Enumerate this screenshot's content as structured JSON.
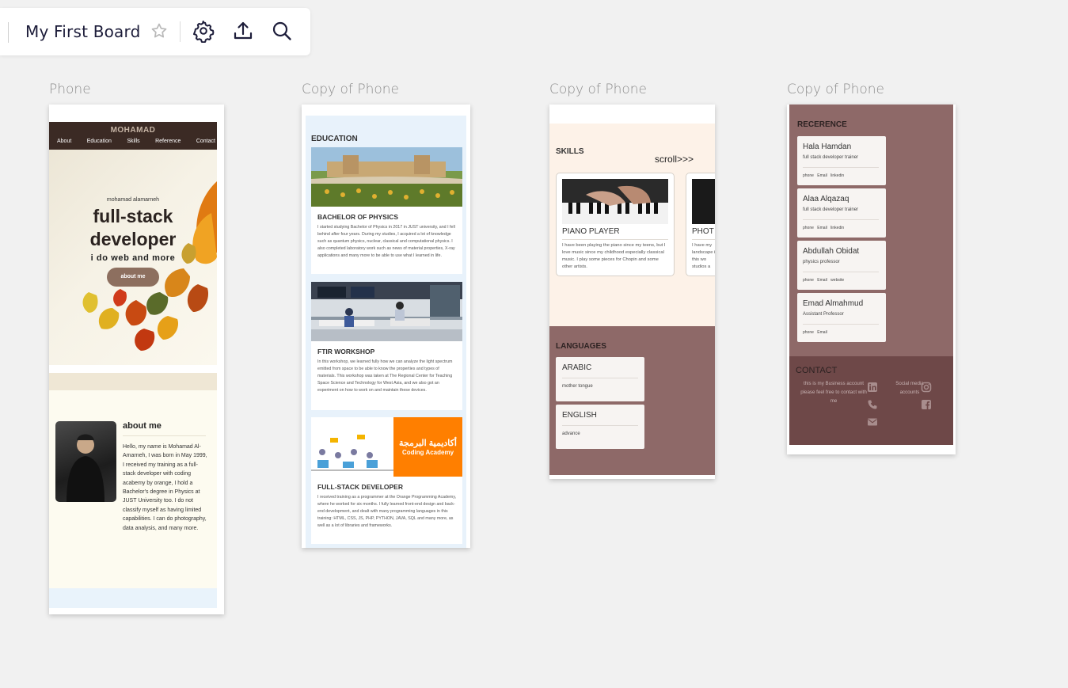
{
  "toolbar": {
    "board_title": "My First Board",
    "icons": [
      "star-icon",
      "gear-icon",
      "upload-icon",
      "search-icon"
    ]
  },
  "frames": [
    {
      "label": "Phone"
    },
    {
      "label": "Copy of Phone"
    },
    {
      "label": "Copy of Phone"
    },
    {
      "label": "Copy of Phone"
    }
  ],
  "phone1": {
    "brand": "MOHAMAD",
    "nav": [
      "About",
      "Education",
      "Skills",
      "Reference",
      "Contact"
    ],
    "hero_sub": "mohamad alamarneh",
    "hero_title_1": "full-stack",
    "hero_title_2": "developer",
    "hero_tagline": "i do web and more",
    "hero_button": "about me",
    "about_heading": "about me",
    "about_body": "Hello, my name is Mohamad Al-Amarneh, I was born in May 1999, I received my training as a full-stack developer with coding acabemy by orange, I hold a Bachelor's degree in Physics at JUST University too. I do not classify myself as having limited capabilities. I can do photography, data analysis, and many more."
  },
  "phone2": {
    "section_title": "EDUCATION",
    "cards": [
      {
        "title": "BACHELOR OF PHYSICS",
        "body": "I started studying Bachelor of Physics in 2017 in JUST university, and I fell behind after four years. During my studies, I acquired a lot of knowledge such as quantum physics, nuclear, classical and computational physics. I also completed laboratory work such as news of material properties, X-ray applications and many more to be able to use what I learned in life."
      },
      {
        "title": "FTIR WORKSHOP",
        "body": "In this workshop, we learned fully how we can analyze the light spectrum emitted from space to be able to know the properties and types of materials. This workshop was taken at The Regional Center for Teaching Space Science and Technology for West Asia, and we also got an experiment on how to work on and maintain these devices."
      },
      {
        "title": "FULL-STACK DEVELOPER",
        "body": "I received training as a programmer at the Orange Programming Academy, where he worked for six months. I fully learned front-end design and back-end development, and dealt with many programming languages in this training: HTML, CSS, JS, PHP, PYTHON, JAVA, SQL and many more, as well as a lot of libraries and frameworks."
      }
    ],
    "academy_ar": "أكاديمية البرمجة",
    "academy_en": "Coding Academy"
  },
  "phone3": {
    "skills_title": "SKILLS",
    "scroll_hint": "scroll>>>",
    "skills": [
      {
        "title": "PIANO PLAYER",
        "body": "I have been playing the piano since my teens, but I love music since my childhood especially classical music. I play some pieces for Chopin and some other artists."
      },
      {
        "title": "PHOT",
        "body": "I have my landscape in this wo studios a"
      }
    ],
    "languages_title": "LANGUAGES",
    "languages": [
      {
        "name": "ARABIC",
        "level": "mother tongue"
      },
      {
        "name": "ENGLISH",
        "level": "advance"
      }
    ]
  },
  "phone4": {
    "ref_title": "RECERENCE",
    "refs": [
      {
        "name": "Hala Hamdan",
        "role": "full stack developer trainer",
        "links": "phone Email linkedin"
      },
      {
        "name": "Alaa Alqazaq",
        "role": "full stack developer trainer",
        "links": "phone Email linkedin"
      },
      {
        "name": "Abdullah Obidat",
        "role": "physics professor",
        "links": "phone Email website"
      },
      {
        "name": "Emad Almahmud",
        "role": "Assistant Professor",
        "links": "phone Email"
      }
    ],
    "contact_title": "CONTACT",
    "contact_text": "this is my Business account please feel free to contact with me",
    "social_text": "Social media accounts"
  },
  "colors": {
    "canvas_bg": "#f1f1f1",
    "nav_brown": "#3b2a24",
    "mauve": "#8e6968",
    "contact_bg": "#6e4848",
    "academy_orange": "#ff7f00"
  }
}
